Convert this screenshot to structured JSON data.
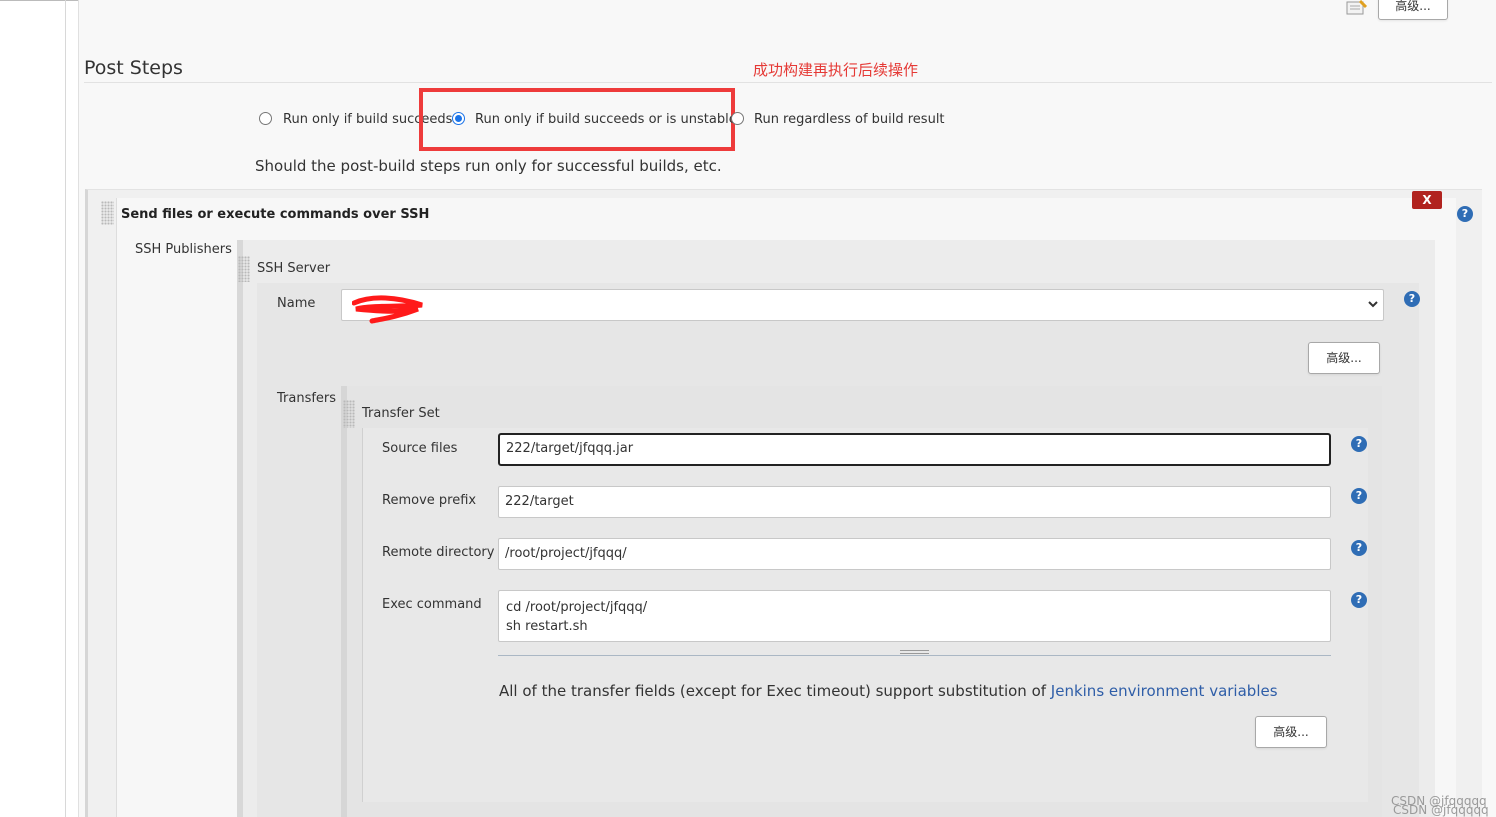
{
  "top": {
    "advanced_label": "高级..."
  },
  "post_steps": {
    "title": "Post Steps",
    "annotation": "成功构建再执行后续操作",
    "options": [
      {
        "label": "Run only if build succeeds",
        "checked": false
      },
      {
        "label": "Run only if build succeeds or is unstable",
        "checked": true
      },
      {
        "label": "Run regardless of build result",
        "checked": false
      }
    ],
    "description": "Should the post-build steps run only for successful builds, etc."
  },
  "ssh": {
    "title": "Send files or execute commands over SSH",
    "delete_label": "X",
    "publishers_label": "SSH Publishers",
    "server_label": "SSH Server",
    "name_label": "Name",
    "name_value": "",
    "server_advanced_label": "高级...",
    "transfers_label": "Transfers",
    "transfer_set_label": "Transfer Set",
    "fields": {
      "source_files_label": "Source files",
      "source_files_value": "222/target/jfqqq.jar",
      "remove_prefix_label": "Remove prefix",
      "remove_prefix_value": "222/target",
      "remote_directory_label": "Remote directory",
      "remote_directory_value": "/root/project/jfqqq/",
      "exec_command_label": "Exec command",
      "exec_command_value": "cd /root/project/jfqqq/\nsh restart.sh"
    },
    "note_prefix": "All of the transfer fields (except for Exec timeout) support substitution of ",
    "note_link": "Jenkins environment variables",
    "transfer_advanced_label": "高级..."
  },
  "help_label": "?",
  "watermark": "CSDN @jfqqqqq",
  "colors": {
    "accent": "#1a73e8",
    "annotation": "#e53935",
    "link": "#2f5ea8",
    "delete": "#b1231f",
    "help": "#2f6db5"
  }
}
